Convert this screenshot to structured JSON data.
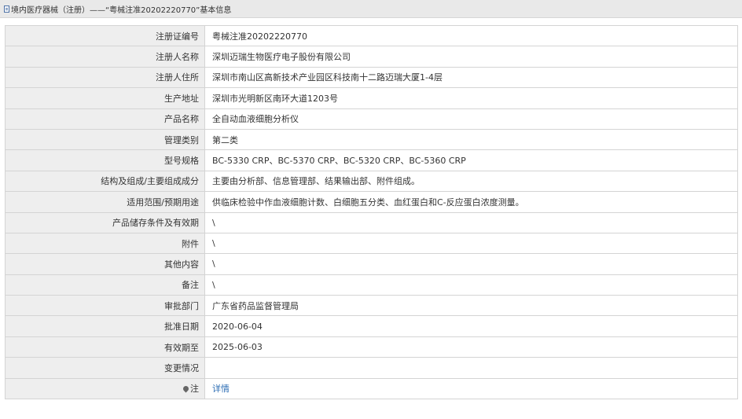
{
  "breadcrumb": {
    "icon": "document-icon",
    "text": "境内医疗器械（注册）——“粤械注准20202220770”基本信息"
  },
  "rows": [
    {
      "label": "注册证编号",
      "value": "粤械注准20202220770"
    },
    {
      "label": "注册人名称",
      "value": "深圳迈瑞生物医疗电子股份有限公司"
    },
    {
      "label": "注册人住所",
      "value": "深圳市南山区高新技术产业园区科技南十二路迈瑞大厦1-4层"
    },
    {
      "label": "生产地址",
      "value": "深圳市光明新区南环大道1203号"
    },
    {
      "label": "产品名称",
      "value": "全自动血液细胞分析仪"
    },
    {
      "label": "管理类别",
      "value": "第二类"
    },
    {
      "label": "型号规格",
      "value": "BC-5330 CRP、BC-5370 CRP、BC-5320 CRP、BC-5360 CRP"
    },
    {
      "label": "结构及组成/主要组成成分",
      "value": "主要由分析部、信息管理部、结果输出部、附件组成。"
    },
    {
      "label": "适用范围/预期用途",
      "value": "供临床检验中作血液细胞计数、白细胞五分类、血红蛋白和C-反应蛋白浓度测量。"
    },
    {
      "label": "产品储存条件及有效期",
      "value": "\\"
    },
    {
      "label": "附件",
      "value": "\\"
    },
    {
      "label": "其他内容",
      "value": "\\"
    },
    {
      "label": "备注",
      "value": "\\"
    },
    {
      "label": "审批部门",
      "value": "广东省药品监督管理局"
    },
    {
      "label": "批准日期",
      "value": "2020-06-04"
    },
    {
      "label": "有效期至",
      "value": "2025-06-03"
    },
    {
      "label": "变更情况",
      "value": ""
    }
  ],
  "note_row": {
    "icon": "pin-icon",
    "label": "注",
    "link_text": "详情"
  }
}
